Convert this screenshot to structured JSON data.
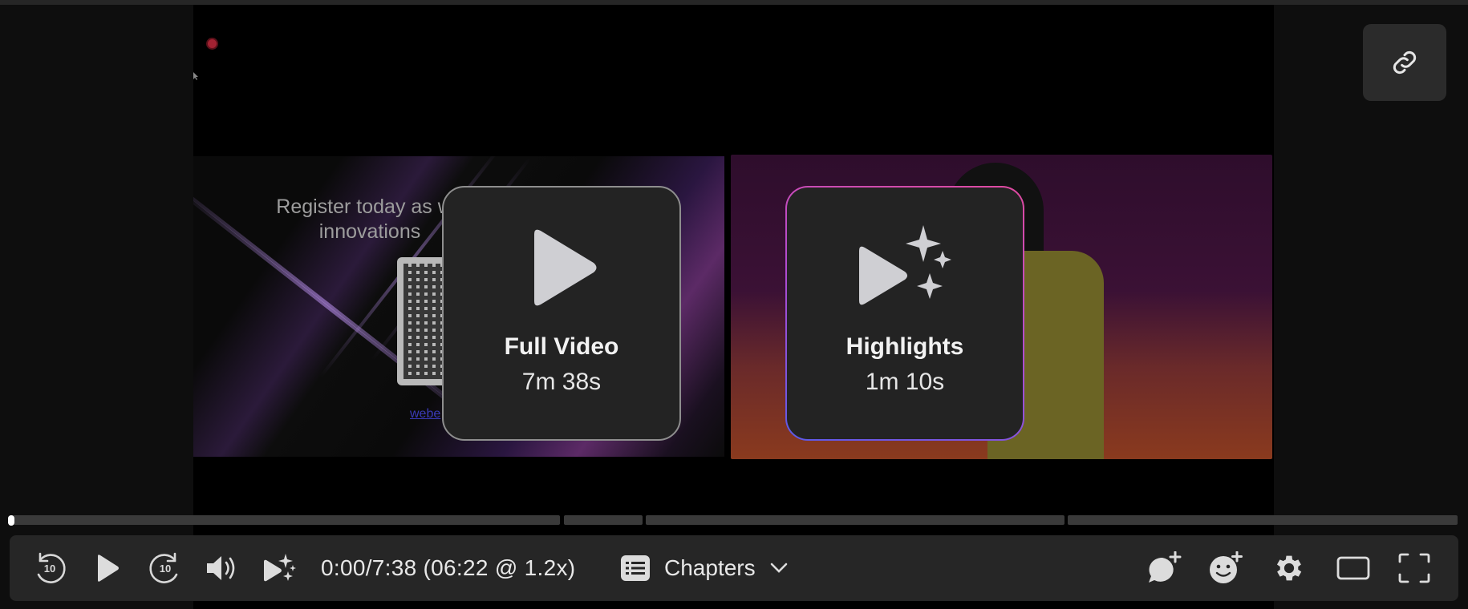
{
  "cards": [
    {
      "title": "Full Video",
      "duration": "7m 38s",
      "icon": "play-icon"
    },
    {
      "title": "Highlights",
      "duration": "1m 10s",
      "icon": "play-sparkle-icon"
    }
  ],
  "slide": {
    "text_line1": "Register today as we",
    "text_line2": "innovations",
    "link_text": "webe"
  },
  "player": {
    "time": "0:00/7:38 (06:22 @ 1.2x)",
    "chapters_label": "Chapters",
    "progress_fraction": 0.0
  },
  "icons": {
    "link": "link-icon",
    "rewind": "rewind-10-icon",
    "play": "play-icon",
    "forward": "forward-10-icon",
    "volume": "volume-icon",
    "highlights": "play-sparkle-icon",
    "chapters": "list-icon",
    "chevron": "chevron-down-icon",
    "comment": "add-comment-icon",
    "reaction": "add-reaction-icon",
    "settings": "gear-icon",
    "theater": "theater-mode-icon",
    "fullscreen": "fullscreen-icon"
  },
  "colors": {
    "card_bg": "#232323",
    "highlight_border_start": "#e04aa0",
    "highlight_border_end": "#5b5ae8",
    "control_bar": "#262626"
  }
}
